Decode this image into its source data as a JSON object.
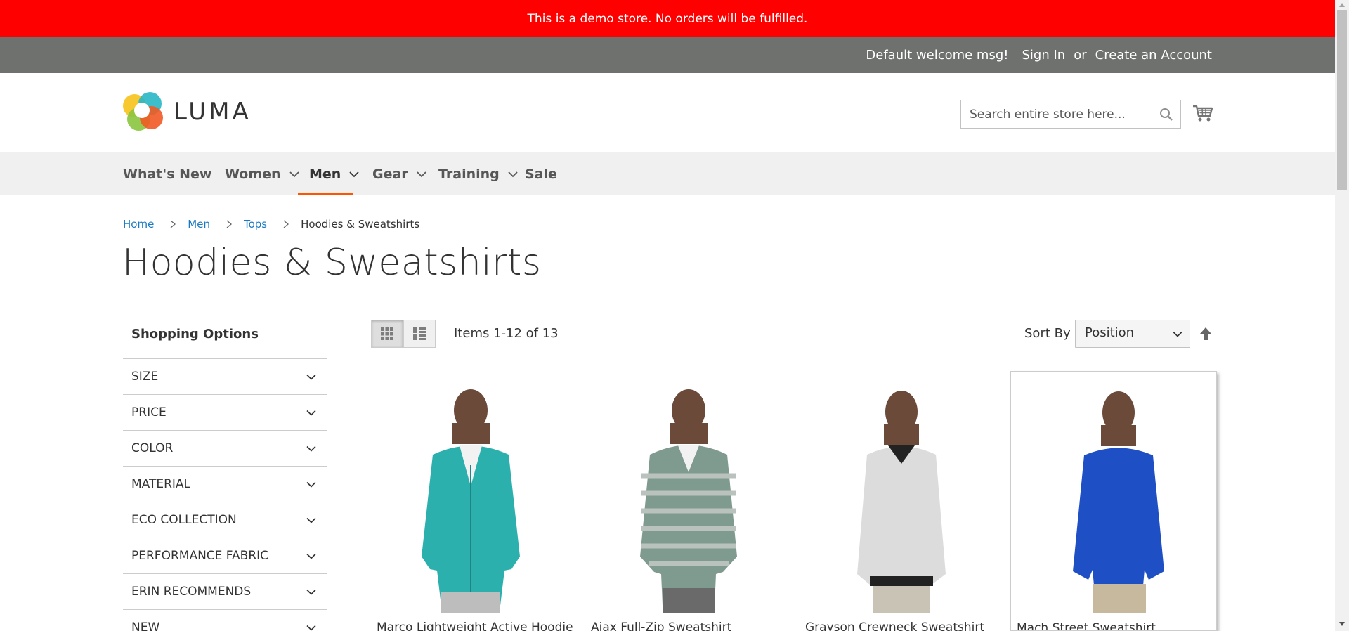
{
  "demo_notice": "This is a demo store. No orders will be fulfilled.",
  "panel": {
    "welcome": "Default welcome msg!",
    "sign_in": "Sign In",
    "or": "or",
    "create_account": "Create an Account"
  },
  "header": {
    "logo_text": "LUMA",
    "search_placeholder": "Search entire store here...",
    "search_value": "",
    "cart_icon": "cart-icon",
    "search_icon": "magnifier-icon"
  },
  "nav": {
    "items": [
      {
        "label": "What's New",
        "has_dropdown": false
      },
      {
        "label": "Women",
        "has_dropdown": true
      },
      {
        "label": "Men",
        "has_dropdown": true,
        "active": true
      },
      {
        "label": "Gear",
        "has_dropdown": true
      },
      {
        "label": "Training",
        "has_dropdown": true
      },
      {
        "label": "Sale",
        "has_dropdown": false
      }
    ],
    "active_color": "#ff5501"
  },
  "breadcrumbs": [
    {
      "label": "Home",
      "link": true
    },
    {
      "label": "Men",
      "link": true
    },
    {
      "label": "Tops",
      "link": true
    },
    {
      "label": "Hoodies & Sweatshirts",
      "link": false
    }
  ],
  "page_title": "Hoodies & Sweatshirts",
  "sidebar": {
    "title": "Shopping Options",
    "filters": [
      "SIZE",
      "PRICE",
      "COLOR",
      "MATERIAL",
      "ECO COLLECTION",
      "PERFORMANCE FABRIC",
      "ERIN RECOMMENDS",
      "NEW"
    ]
  },
  "toolbar": {
    "grid_icon": "grid-view-icon",
    "list_icon": "list-view-icon",
    "amount": "Items 1-12 of 13",
    "sort_label": "Sort By",
    "sort_value": "Position",
    "sort_direction_icon": "sort-ascending-arrow-icon"
  },
  "products": [
    {
      "name": "Marco Lightweight Active Hoodie",
      "color": "#2bb0ae",
      "pants": "#bdbdbd"
    },
    {
      "name": "Ajax Full-Zip Sweatshirt",
      "color": "#7f9a8f",
      "pants": "#6a6a6a"
    },
    {
      "name": "Grayson Crewneck Sweatshirt",
      "color": "#dcdcdc",
      "pants": "#c9c3b5"
    },
    {
      "name": "Mach Street Sweatshirt",
      "color": "#1f4fc4",
      "pants": "#c7b99e"
    }
  ],
  "colors": {
    "demo_bar": "#ff0000",
    "panel_header": "#6e716e",
    "link": "#1979c3",
    "nav_bg": "#f0f0f0"
  }
}
